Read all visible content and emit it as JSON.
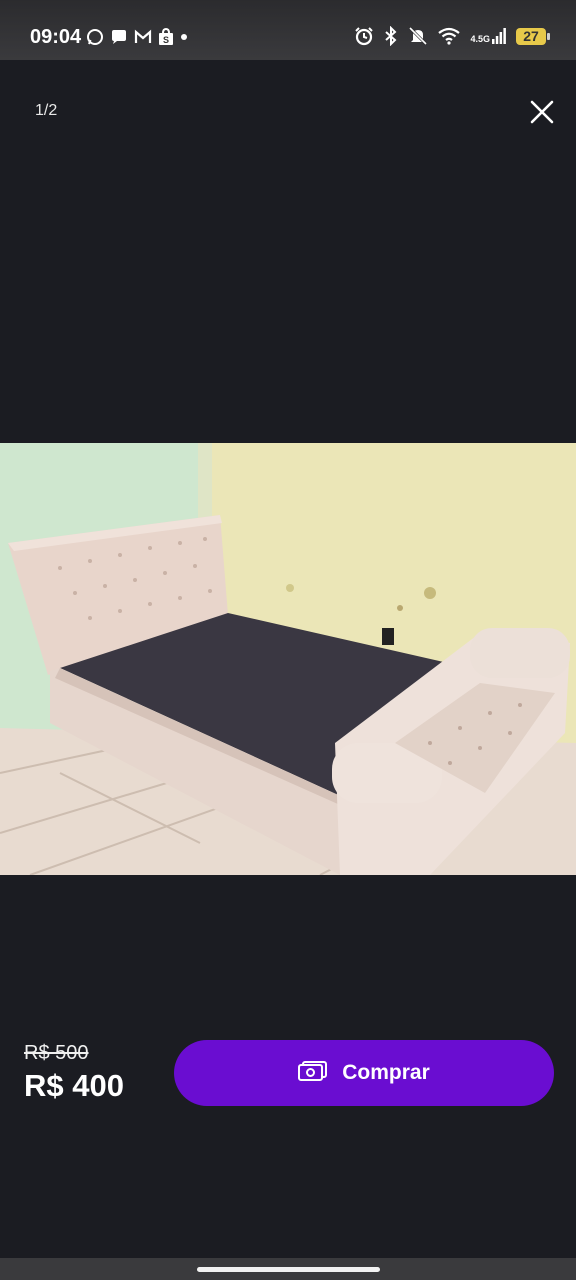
{
  "status_bar": {
    "time": "09:04",
    "left_icons": [
      "whatsapp-icon",
      "chat-icon",
      "gmail-icon",
      "shopping-bag-icon",
      "dot-icon"
    ],
    "right_icons": [
      "alarm-icon",
      "bluetooth-icon",
      "mute-icon",
      "wifi-icon",
      "signal-icon"
    ],
    "network": "4.5G",
    "battery": "27",
    "battery_color": "#e7c94a"
  },
  "viewer": {
    "counter": "1/2",
    "close_icon": "close-icon"
  },
  "photo": {
    "description_icon": "product-photo"
  },
  "purchase": {
    "old_price": "R$ 500",
    "price": "R$ 400",
    "button_label": "Comprar",
    "button_icon": "money-icon",
    "accent": "#6a0dd1"
  }
}
